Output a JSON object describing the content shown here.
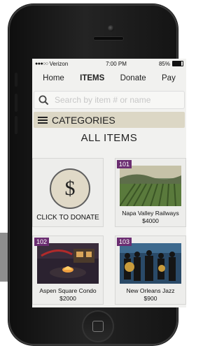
{
  "status": {
    "carrier": "Verizon",
    "time": "7:00 PM",
    "battery": "85%"
  },
  "nav": {
    "items": [
      "Home",
      "ITEMS",
      "Donate",
      "Pay"
    ],
    "active": "ITEMS"
  },
  "search": {
    "placeholder": "Search by item # or name",
    "icon": "search-icon"
  },
  "categories": {
    "label": "CATEGORIES",
    "icon": "hamburger-menu-icon"
  },
  "section_title": "ALL ITEMS",
  "donate_card": {
    "symbol": "$",
    "label": "CLICK TO DONATE"
  },
  "items": [
    {
      "number": "101",
      "name": "Napa Valley Railways",
      "price": "$4000"
    },
    {
      "number": "102",
      "name": "Aspen Square Condo",
      "price": "$2000"
    },
    {
      "number": "103",
      "name": "New Orleans Jazz",
      "price": "$900"
    }
  ],
  "colors": {
    "accent_badge": "#6b2d71",
    "category_bar": "#dcd7c5",
    "screen_bg": "#f1f1ef"
  }
}
